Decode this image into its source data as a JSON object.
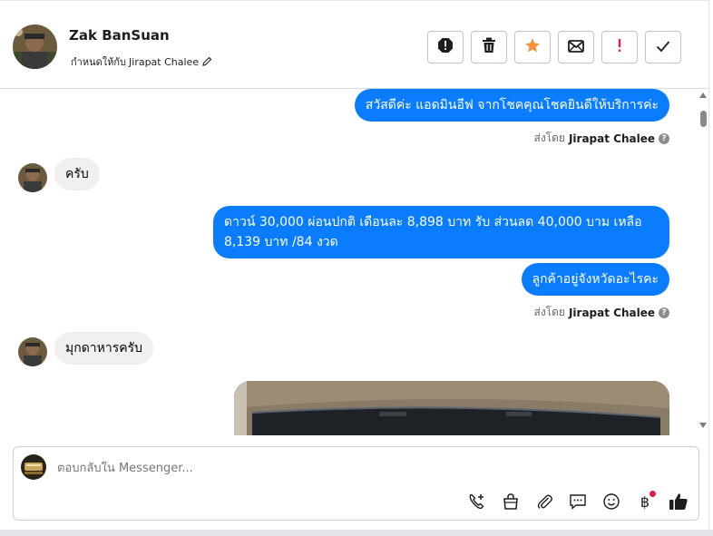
{
  "header": {
    "contact_name": "Zak BanSuan",
    "assign_label": "กำหนดให้กับ",
    "assignee": "Jirapat Chalee",
    "actions": [
      {
        "name": "report-icon",
        "label": "!"
      },
      {
        "name": "trash-icon"
      },
      {
        "name": "star-icon",
        "color": "#f7923a"
      },
      {
        "name": "envelope-icon"
      },
      {
        "name": "exclamation-icon",
        "color": "#e41e3f"
      },
      {
        "name": "checkmark-icon"
      }
    ]
  },
  "thread": {
    "messages": [
      {
        "direction": "out",
        "text": "สวัสดีค่ะ แอดมินอีฟ จากโชคคุณโชคยินดีให้บริการค่ะ"
      },
      {
        "direction": "in",
        "text": "ครับ"
      },
      {
        "direction": "out",
        "text": "ดาวน์ 30,000 ผ่อนปกติ เดือนละ 8,898 บาท   รับ ส่วนลด 40,000 บาม เหลือ 8,139 บาท /84 งวด"
      },
      {
        "direction": "out",
        "text": "ลูกค้าอยู่จังหวัดอะไรคะ"
      },
      {
        "direction": "in",
        "text": "มุกดาหารครับ"
      }
    ],
    "sent_by_label": "ส่งโดย",
    "sent_by_name": "Jirapat Chalee",
    "info_glyph": "?"
  },
  "composer": {
    "placeholder": "ตอบกลับใน Messenger...",
    "icons": [
      "call-add-icon",
      "shopping-bag-icon",
      "paperclip-icon",
      "saved-reply-icon",
      "emoji-icon",
      "baht-payment-icon",
      "thumbs-up-icon"
    ],
    "baht_glyph": "฿"
  },
  "colors": {
    "outgoing_bubble": "#0a7cff",
    "incoming_bubble": "#f0f0f0",
    "star": "#f7923a",
    "alert": "#e41e3f"
  }
}
